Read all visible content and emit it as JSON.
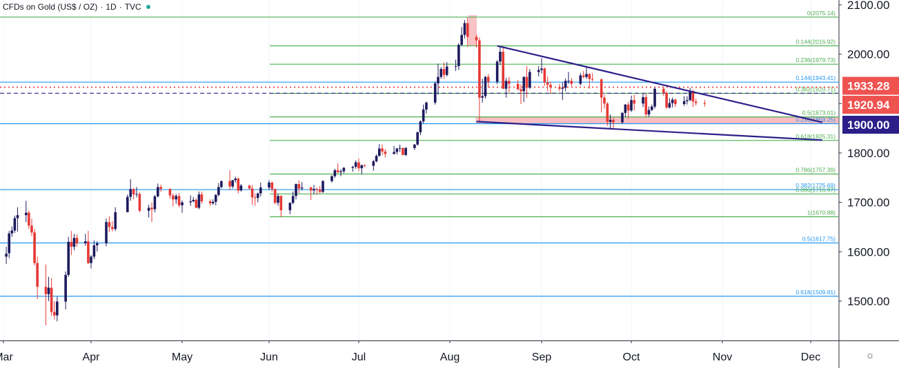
{
  "header": {
    "symbol": "CFDs on Gold (US$ / OZ)",
    "interval": "1D",
    "source": "TVC",
    "status_color": "#26a69a"
  },
  "colors": {
    "up": "#1e1a5e",
    "down": "#e53935",
    "fib_green": "#4caf50",
    "fib_blue": "#2196f3",
    "trendline": "#2c1f8a",
    "red_dotted": "#ef5350",
    "navy_dashed": "#2c1f8a",
    "support_zone": "#f7b3b6"
  },
  "settings_icon": "gear-icon",
  "chart_data": {
    "type": "candlestick",
    "title": "CFDs on Gold (US$ / OZ) · 1D · TVC",
    "x_axis": {
      "months": [
        "Mar",
        "Apr",
        "May",
        "Jun",
        "Jul",
        "Aug",
        "Sep",
        "Oct",
        "Nov",
        "Dec"
      ]
    },
    "y_axis": {
      "ticks": [
        "2100.00",
        "2000.00",
        "1900.00",
        "1800.00",
        "1700.00",
        "1600.00",
        "1500.00"
      ],
      "min": 1420,
      "max": 2108
    },
    "price_tags": [
      {
        "label": "1933.28",
        "value": 1933.28,
        "color": "#ef5350"
      },
      {
        "label": "1920.94",
        "value": 1920.94,
        "color": "#ef5350"
      },
      {
        "label": "1900.00",
        "value": 1900.0,
        "color": "#2c1f8a"
      }
    ],
    "fib_levels": [
      {
        "label": "0(2075.14)",
        "value": 2075.14,
        "color": "green",
        "start": "Feb"
      },
      {
        "label": "0.144(2016.92)",
        "value": 2016.92,
        "color": "green",
        "start": "Jun"
      },
      {
        "label": "0.236(1979.73)",
        "value": 1979.73,
        "color": "green",
        "start": "Jun"
      },
      {
        "label": "0.144(1943.41)",
        "value": 1943.41,
        "color": "blue",
        "start": "Feb"
      },
      {
        "label": "0.382(1920.71)",
        "value": 1920.71,
        "color": "green",
        "start": "Jun"
      },
      {
        "label": "0.5(1873.01)",
        "value": 1873.01,
        "color": "green",
        "start": "Jun"
      },
      {
        "label": "0.236(1859.25)",
        "value": 1859.25,
        "color": "blue",
        "start": "Feb"
      },
      {
        "label": "0.618(1825.31)",
        "value": 1825.31,
        "color": "green",
        "start": "Jun"
      },
      {
        "label": "0.786(1757.39)",
        "value": 1757.39,
        "color": "green",
        "start": "Jun"
      },
      {
        "label": "0.382(1725.69)",
        "value": 1725.69,
        "color": "blue",
        "start": "Feb"
      },
      {
        "label": "0.886(1716.97)",
        "value": 1716.97,
        "color": "green",
        "start": "Jun"
      },
      {
        "label": "1(1670.88)",
        "value": 1670.88,
        "color": "green",
        "start": "Jun"
      },
      {
        "label": "0.5(1617.75)",
        "value": 1617.75,
        "color": "blue",
        "start": "Feb"
      },
      {
        "label": "0.618(1509.81)",
        "value": 1509.81,
        "color": "blue",
        "start": "Feb"
      }
    ],
    "horizontal_lines": [
      {
        "value": 1933.28,
        "style": "dotted",
        "color": "#ef5350"
      },
      {
        "value": 1920.94,
        "style": "dashed",
        "color": "#2c1f8a"
      }
    ],
    "support_zone": {
      "from": 1873.01,
      "to": 1859.25,
      "start": "2020-08-10"
    },
    "trendlines": [
      {
        "from": {
          "date": "2020-08-17",
          "price": 2016.9
        },
        "to": {
          "date": "2020-12-05",
          "price": 1862
        }
      },
      {
        "from": {
          "date": "2020-08-10",
          "price": 1863.6
        },
        "to": {
          "date": "2020-12-05",
          "price": 1826
        }
      }
    ],
    "candles": [
      [
        "2020-02-27",
        1640,
        1647,
        1617,
        1622
      ],
      [
        "2020-03-02",
        1590,
        1610,
        1575,
        1596
      ],
      [
        "2020-03-03",
        1597,
        1642,
        1587,
        1637
      ],
      [
        "2020-03-04",
        1637,
        1651,
        1630,
        1643
      ],
      [
        "2020-03-05",
        1643,
        1673,
        1638,
        1668
      ],
      [
        "2020-03-06",
        1668,
        1690,
        1641,
        1674
      ],
      [
        "2020-03-09",
        1674,
        1703,
        1660,
        1679
      ],
      [
        "2020-03-10",
        1679,
        1683,
        1646,
        1653
      ],
      [
        "2020-03-11",
        1653,
        1667,
        1632,
        1639
      ],
      [
        "2020-03-12",
        1639,
        1646,
        1572,
        1577
      ],
      [
        "2020-03-13",
        1577,
        1590,
        1504,
        1529
      ],
      [
        "2020-03-16",
        1529,
        1574,
        1451,
        1514
      ],
      [
        "2020-03-17",
        1514,
        1549,
        1500,
        1527
      ],
      [
        "2020-03-18",
        1527,
        1547,
        1470,
        1478
      ],
      [
        "2020-03-19",
        1478,
        1500,
        1463,
        1471
      ],
      [
        "2020-03-20",
        1471,
        1509,
        1459,
        1499
      ],
      [
        "2020-03-23",
        1499,
        1560,
        1483,
        1553
      ],
      [
        "2020-03-24",
        1553,
        1630,
        1549,
        1620
      ],
      [
        "2020-03-25",
        1620,
        1642,
        1593,
        1610
      ],
      [
        "2020-03-26",
        1610,
        1636,
        1603,
        1628
      ],
      [
        "2020-03-27",
        1628,
        1635,
        1610,
        1617
      ],
      [
        "2020-03-30",
        1617,
        1636,
        1612,
        1621
      ],
      [
        "2020-03-31",
        1621,
        1642,
        1575,
        1577
      ],
      [
        "2020-04-01",
        1577,
        1593,
        1566,
        1590
      ],
      [
        "2020-04-02",
        1590,
        1623,
        1585,
        1613
      ],
      [
        "2020-04-03",
        1613,
        1621,
        1600,
        1617
      ],
      [
        "2020-04-06",
        1617,
        1667,
        1611,
        1660
      ],
      [
        "2020-04-07",
        1660,
        1672,
        1640,
        1650
      ],
      [
        "2020-04-08",
        1650,
        1662,
        1641,
        1646
      ],
      [
        "2020-04-09",
        1646,
        1690,
        1642,
        1680
      ],
      [
        "2020-04-13",
        1680,
        1716,
        1680,
        1711
      ],
      [
        "2020-04-14",
        1711,
        1747,
        1703,
        1727
      ],
      [
        "2020-04-15",
        1727,
        1729,
        1706,
        1716
      ],
      [
        "2020-04-16",
        1716,
        1731,
        1710,
        1717
      ],
      [
        "2020-04-17",
        1717,
        1720,
        1680,
        1683
      ],
      [
        "2020-04-20",
        1683,
        1695,
        1669,
        1689
      ],
      [
        "2020-04-21",
        1689,
        1700,
        1660,
        1686
      ],
      [
        "2020-04-22",
        1686,
        1715,
        1680,
        1712
      ],
      [
        "2020-04-23",
        1712,
        1738,
        1710,
        1731
      ],
      [
        "2020-04-24",
        1731,
        1736,
        1721,
        1727
      ],
      [
        "2020-04-27",
        1727,
        1729,
        1707,
        1714
      ],
      [
        "2020-04-28",
        1714,
        1718,
        1692,
        1706
      ],
      [
        "2020-04-29",
        1706,
        1717,
        1697,
        1713
      ],
      [
        "2020-04-30",
        1713,
        1719,
        1690,
        1694
      ],
      [
        "2020-05-01",
        1694,
        1704,
        1679,
        1700
      ],
      [
        "2020-05-04",
        1700,
        1714,
        1693,
        1702
      ],
      [
        "2020-05-05",
        1702,
        1711,
        1700,
        1705
      ],
      [
        "2020-05-06",
        1705,
        1708,
        1688,
        1689
      ],
      [
        "2020-05-07",
        1689,
        1722,
        1686,
        1716
      ],
      [
        "2020-05-08",
        1716,
        1722,
        1697,
        1702
      ],
      [
        "2020-05-11",
        1702,
        1706,
        1693,
        1698
      ],
      [
        "2020-05-12",
        1698,
        1706,
        1695,
        1701
      ],
      [
        "2020-05-13",
        1701,
        1717,
        1694,
        1715
      ],
      [
        "2020-05-14",
        1715,
        1739,
        1712,
        1731
      ],
      [
        "2020-05-15",
        1731,
        1744,
        1728,
        1743
      ],
      [
        "2020-05-18",
        1743,
        1765,
        1725,
        1732
      ],
      [
        "2020-05-19",
        1732,
        1745,
        1728,
        1745
      ],
      [
        "2020-05-20",
        1745,
        1752,
        1740,
        1748
      ],
      [
        "2020-05-21",
        1748,
        1750,
        1718,
        1724
      ],
      [
        "2020-05-22",
        1724,
        1737,
        1722,
        1734
      ],
      [
        "2020-05-25",
        1734,
        1735,
        1726,
        1728
      ],
      [
        "2020-05-26",
        1728,
        1735,
        1695,
        1710
      ],
      [
        "2020-05-27",
        1710,
        1718,
        1693,
        1709
      ],
      [
        "2020-05-28",
        1709,
        1720,
        1700,
        1718
      ],
      [
        "2020-05-29",
        1718,
        1740,
        1712,
        1730
      ],
      [
        "2020-06-01",
        1730,
        1745,
        1725,
        1740
      ],
      [
        "2020-06-02",
        1740,
        1742,
        1722,
        1727
      ],
      [
        "2020-06-03",
        1727,
        1728,
        1696,
        1699
      ],
      [
        "2020-06-04",
        1699,
        1718,
        1693,
        1713
      ],
      [
        "2020-06-05",
        1713,
        1714,
        1671,
        1684
      ],
      [
        "2020-06-08",
        1684,
        1700,
        1676,
        1699
      ],
      [
        "2020-06-09",
        1699,
        1722,
        1696,
        1713
      ],
      [
        "2020-06-10",
        1713,
        1738,
        1706,
        1737
      ],
      [
        "2020-06-11",
        1737,
        1744,
        1719,
        1728
      ],
      [
        "2020-06-12",
        1728,
        1741,
        1724,
        1730
      ],
      [
        "2020-06-15",
        1730,
        1732,
        1705,
        1724
      ],
      [
        "2020-06-16",
        1724,
        1735,
        1716,
        1727
      ],
      [
        "2020-06-17",
        1727,
        1730,
        1715,
        1726
      ],
      [
        "2020-06-18",
        1726,
        1733,
        1718,
        1721
      ],
      [
        "2020-06-19",
        1721,
        1745,
        1719,
        1743
      ],
      [
        "2020-06-22",
        1743,
        1755,
        1740,
        1753
      ],
      [
        "2020-06-23",
        1753,
        1768,
        1750,
        1765
      ],
      [
        "2020-06-24",
        1765,
        1779,
        1759,
        1761
      ],
      [
        "2020-06-25",
        1761,
        1767,
        1753,
        1763
      ],
      [
        "2020-06-26",
        1763,
        1771,
        1759,
        1770
      ],
      [
        "2020-06-29",
        1770,
        1774,
        1762,
        1772
      ],
      [
        "2020-06-30",
        1772,
        1785,
        1768,
        1781
      ],
      [
        "2020-07-01",
        1781,
        1789,
        1763,
        1769
      ],
      [
        "2020-07-02",
        1769,
        1777,
        1757,
        1775
      ],
      [
        "2020-07-03",
        1775,
        1777,
        1771,
        1774
      ],
      [
        "2020-07-06",
        1774,
        1786,
        1764,
        1783
      ],
      [
        "2020-07-07",
        1783,
        1797,
        1781,
        1794
      ],
      [
        "2020-07-08",
        1794,
        1818,
        1793,
        1809
      ],
      [
        "2020-07-09",
        1809,
        1817,
        1796,
        1803
      ],
      [
        "2020-07-10",
        1803,
        1808,
        1791,
        1798
      ],
      [
        "2020-07-13",
        1798,
        1814,
        1797,
        1802
      ],
      [
        "2020-07-14",
        1802,
        1810,
        1797,
        1809
      ],
      [
        "2020-07-15",
        1809,
        1817,
        1802,
        1810
      ],
      [
        "2020-07-16",
        1810,
        1811,
        1795,
        1796
      ],
      [
        "2020-07-17",
        1796,
        1812,
        1794,
        1810
      ],
      [
        "2020-07-20",
        1810,
        1818,
        1806,
        1817
      ],
      [
        "2020-07-21",
        1817,
        1843,
        1815,
        1842
      ],
      [
        "2020-07-22",
        1842,
        1866,
        1836,
        1864
      ],
      [
        "2020-07-23",
        1864,
        1898,
        1860,
        1888
      ],
      [
        "2020-07-24",
        1888,
        1904,
        1880,
        1902
      ],
      [
        "2020-07-27",
        1902,
        1945,
        1898,
        1941
      ],
      [
        "2020-07-28",
        1941,
        1981,
        1918,
        1954
      ],
      [
        "2020-07-29",
        1954,
        1974,
        1950,
        1970
      ],
      [
        "2020-07-30",
        1970,
        1983,
        1950,
        1958
      ],
      [
        "2020-07-31",
        1958,
        1984,
        1955,
        1975
      ],
      [
        "2020-08-03",
        1975,
        1989,
        1966,
        1976
      ],
      [
        "2020-08-04",
        1976,
        2022,
        1968,
        2019
      ],
      [
        "2020-08-05",
        2019,
        2055,
        2016,
        2039
      ],
      [
        "2020-08-06",
        2039,
        2069,
        2032,
        2063
      ],
      [
        "2020-08-07",
        2063,
        2075,
        2015,
        2035
      ],
      [
        "2020-08-10",
        2035,
        2040,
        2013,
        2028
      ],
      [
        "2020-08-11",
        2028,
        2034,
        1863,
        1912
      ],
      [
        "2020-08-12",
        1912,
        1950,
        1902,
        1915
      ],
      [
        "2020-08-13",
        1915,
        1956,
        1910,
        1954
      ],
      [
        "2020-08-14",
        1954,
        1960,
        1933,
        1944
      ],
      [
        "2020-08-17",
        1944,
        1988,
        1939,
        1985
      ],
      [
        "2020-08-18",
        1985,
        2015,
        1978,
        2005
      ],
      [
        "2020-08-19",
        2005,
        2014,
        1930,
        1930
      ],
      [
        "2020-08-20",
        1930,
        1952,
        1912,
        1946
      ],
      [
        "2020-08-21",
        1946,
        1954,
        1922,
        1940
      ],
      [
        "2020-08-24",
        1940,
        1948,
        1927,
        1929
      ],
      [
        "2020-08-25",
        1929,
        1939,
        1899,
        1925
      ],
      [
        "2020-08-26",
        1925,
        1955,
        1903,
        1954
      ],
      [
        "2020-08-27",
        1954,
        1976,
        1912,
        1932
      ],
      [
        "2020-08-28",
        1932,
        1970,
        1930,
        1964
      ],
      [
        "2020-08-31",
        1964,
        1976,
        1955,
        1968
      ],
      [
        "2020-09-01",
        1968,
        1992,
        1961,
        1971
      ],
      [
        "2020-09-02",
        1971,
        1973,
        1936,
        1943
      ],
      [
        "2020-09-03",
        1943,
        1955,
        1925,
        1938
      ],
      [
        "2020-09-04",
        1938,
        1944,
        1919,
        1933
      ],
      [
        "2020-09-07",
        1933,
        1940,
        1925,
        1930
      ],
      [
        "2020-09-08",
        1930,
        1943,
        1907,
        1932
      ],
      [
        "2020-09-09",
        1932,
        1951,
        1925,
        1946
      ],
      [
        "2020-09-10",
        1946,
        1964,
        1940,
        1946
      ],
      [
        "2020-09-11",
        1946,
        1952,
        1935,
        1940
      ],
      [
        "2020-09-14",
        1940,
        1962,
        1937,
        1957
      ],
      [
        "2020-09-15",
        1957,
        1966,
        1951,
        1954
      ],
      [
        "2020-09-16",
        1954,
        1973,
        1950,
        1960
      ],
      [
        "2020-09-17",
        1960,
        1961,
        1930,
        1950
      ],
      [
        "2020-09-18",
        1950,
        1962,
        1945,
        1949
      ],
      [
        "2020-09-21",
        1949,
        1951,
        1882,
        1912
      ],
      [
        "2020-09-22",
        1912,
        1918,
        1890,
        1900
      ],
      [
        "2020-09-23",
        1900,
        1903,
        1855,
        1863
      ],
      [
        "2020-09-24",
        1863,
        1878,
        1848,
        1867
      ],
      [
        "2020-09-25",
        1867,
        1871,
        1850,
        1862
      ],
      [
        "2020-09-28",
        1862,
        1883,
        1859,
        1881
      ],
      [
        "2020-09-29",
        1881,
        1899,
        1873,
        1898
      ],
      [
        "2020-09-30",
        1898,
        1903,
        1870,
        1886
      ],
      [
        "2020-10-01",
        1886,
        1916,
        1883,
        1907
      ],
      [
        "2020-10-02",
        1907,
        1918,
        1886,
        1900
      ],
      [
        "2020-10-05",
        1900,
        1920,
        1893,
        1913
      ],
      [
        "2020-10-06",
        1913,
        1920,
        1873,
        1878
      ],
      [
        "2020-10-07",
        1878,
        1894,
        1873,
        1887
      ],
      [
        "2020-10-08",
        1887,
        1898,
        1885,
        1894
      ],
      [
        "2020-10-09",
        1894,
        1933,
        1890,
        1930
      ],
      [
        "2020-10-12",
        1930,
        1934,
        1915,
        1922
      ],
      [
        "2020-10-13",
        1922,
        1925,
        1889,
        1892
      ],
      [
        "2020-10-14",
        1892,
        1911,
        1890,
        1901
      ],
      [
        "2020-10-15",
        1901,
        1912,
        1892,
        1908
      ],
      [
        "2020-10-16",
        1908,
        1910,
        1893,
        1899
      ],
      [
        "2020-10-19",
        1899,
        1915,
        1895,
        1905
      ],
      [
        "2020-10-20",
        1905,
        1915,
        1898,
        1907
      ],
      [
        "2020-10-21",
        1907,
        1932,
        1905,
        1925
      ],
      [
        "2020-10-22",
        1925,
        1928,
        1893,
        1904
      ],
      [
        "2020-10-23",
        1904,
        1910,
        1896,
        1901
      ],
      [
        "2020-10-26",
        1901,
        1907,
        1894,
        1900
      ]
    ]
  }
}
